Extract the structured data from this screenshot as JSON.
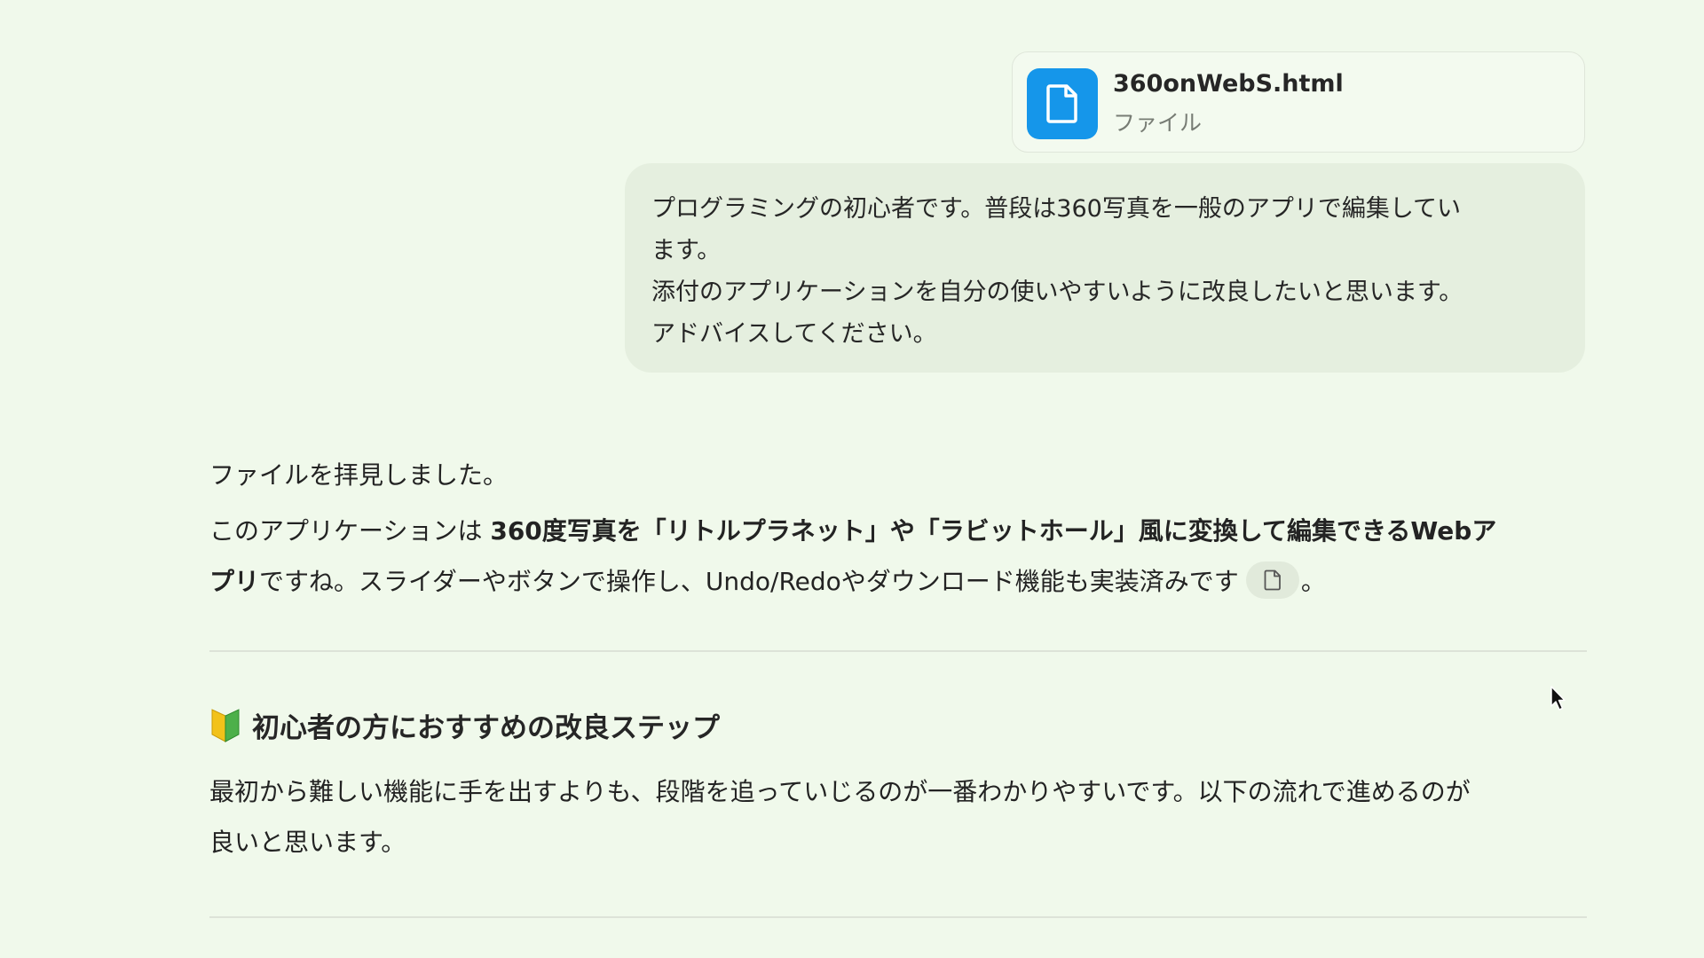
{
  "attachment": {
    "file_name": "360onWebS.html",
    "file_type": "ファイル",
    "icon": "document-icon",
    "icon_color": "#1596ea"
  },
  "user_message": {
    "lines": [
      "プログラミングの初心者です。普段は360写真を一般のアプリで編集してい",
      "ます。",
      "添付のアプリケーションを自分の使いやすいように改良したいと思います。",
      "アドバイスしてください。"
    ]
  },
  "response": {
    "intro": "ファイルを拝見しました。",
    "para": {
      "prefix": "このアプリケーションは ",
      "bold": "360度写真を「リトルプラネット」や「ラビットホール」風に変換して編集できるWebア",
      "line2_bold": "プリ",
      "line2_rest": "ですね。スライダーやボタンで操作し、Undo/Redoやダウンロード機能も実装済みです",
      "cite_icon": "document-icon",
      "suffix": "。"
    },
    "section": {
      "emoji_icon": "beginner-mark-icon",
      "title": "初心者の方におすすめの改良ステップ",
      "body_lines": [
        "最初から難しい機能に手を出すよりも、段階を追っていじるのが一番わかりやすいです。以下の流れで進めるのが",
        "良いと思います。"
      ]
    }
  },
  "colors": {
    "background": "#f0f9eb",
    "bubble": "#e5efdf",
    "accent": "#1596ea"
  }
}
